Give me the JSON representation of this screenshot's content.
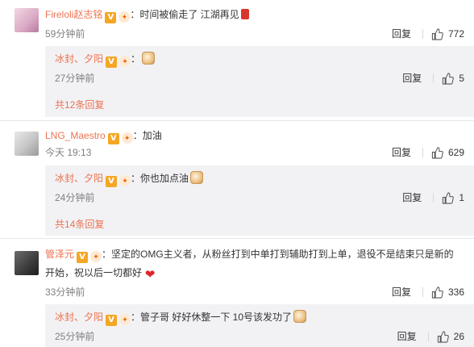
{
  "reply_label": "回复",
  "comments": [
    {
      "user": "Fireloli赵志铭",
      "text": "：时间被偷走了 江湖再见",
      "time": "59分钟前",
      "likes": "772",
      "sub": {
        "user": "冰封、夕阳",
        "text": "：",
        "time": "27分钟前",
        "likes": "5"
      },
      "more": "共12条回复"
    },
    {
      "user": "LNG_Maestro",
      "text": "：加油",
      "time": "今天 19:13",
      "likes": "629",
      "sub": {
        "user": "冰封、夕阳",
        "text": "：你也加点油",
        "time": "24分钟前",
        "likes": "1"
      },
      "more": "共14条回复"
    },
    {
      "user": "管泽元",
      "text_line1": "：坚定的OMG主义者，从粉丝打到中单打到辅助打到上单，退役不是结束只是新的",
      "text_line2": "开始，祝以后一切都好",
      "time": "33分钟前",
      "likes": "336",
      "sub": {
        "user": "冰封、夕阳",
        "text": "：管子哥 好好休整一下 10号该发功了",
        "time": "25分钟前",
        "likes": "26"
      }
    }
  ]
}
